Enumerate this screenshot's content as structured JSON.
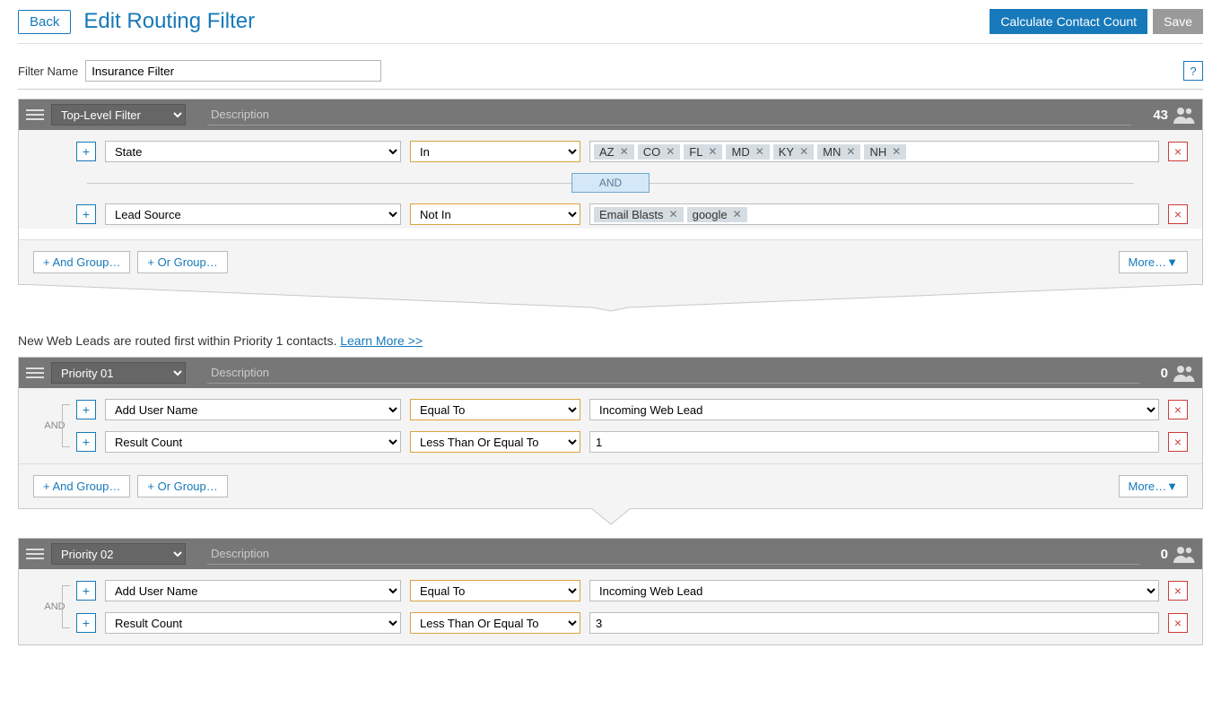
{
  "header": {
    "back": "Back",
    "title": "Edit Routing Filter",
    "calc": "Calculate Contact Count",
    "save": "Save"
  },
  "nameRow": {
    "label": "Filter Name",
    "value": "Insurance Filter",
    "help": "?"
  },
  "footer_buttons": {
    "and_group": "+ And Group…",
    "or_group": "+ Or Group…",
    "more": "More…▼"
  },
  "desc_placeholder": "Description",
  "topFilter": {
    "select": "Top-Level Filter",
    "count": "43",
    "connector": "AND",
    "rows": [
      {
        "field": "State",
        "op": "In",
        "tags": [
          "AZ",
          "CO",
          "FL",
          "MD",
          "KY",
          "MN",
          "NH"
        ]
      },
      {
        "field": "Lead Source",
        "op": "Not In",
        "tags": [
          "Email Blasts",
          "google"
        ]
      }
    ]
  },
  "info": {
    "text": "New Web Leads are routed first within Priority 1 contacts. ",
    "link": "Learn More >>"
  },
  "p1": {
    "select": "Priority 01",
    "count": "0",
    "and_label": "AND",
    "rows": [
      {
        "field": "Add User Name",
        "op": "Equal To",
        "value": "Incoming Web Lead",
        "valueType": "select"
      },
      {
        "field": "Result Count",
        "op": "Less Than Or Equal To",
        "value": "1",
        "valueType": "input"
      }
    ]
  },
  "p2": {
    "select": "Priority 02",
    "count": "0",
    "and_label": "AND",
    "rows": [
      {
        "field": "Add User Name",
        "op": "Equal To",
        "value": "Incoming Web Lead",
        "valueType": "select"
      },
      {
        "field": "Result Count",
        "op": "Less Than Or Equal To",
        "value": "3",
        "valueType": "input"
      }
    ]
  }
}
